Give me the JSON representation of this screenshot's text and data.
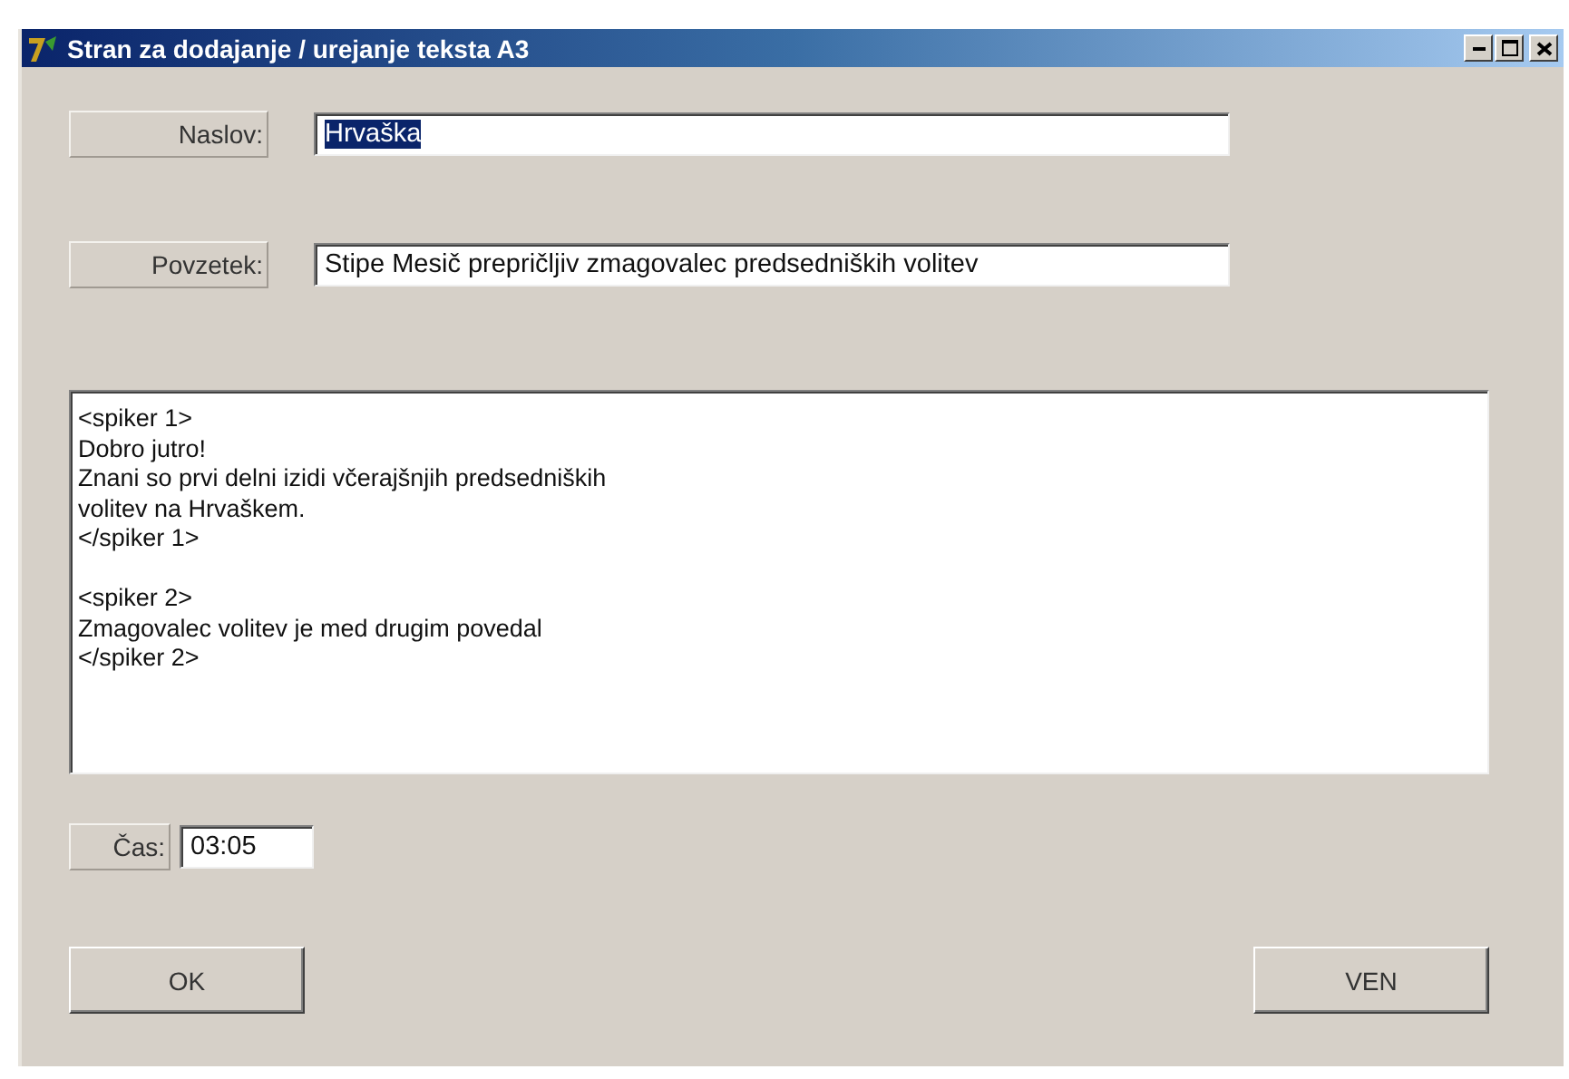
{
  "window": {
    "title": "Stran za dodajanje / urejanje teksta A3"
  },
  "fields": [
    {
      "label": "Naslov:",
      "value": "Hrvaška",
      "selected": true
    },
    {
      "label": "Povzetek:",
      "value": "Stipe Mesič prepričljiv zmagovalec predsedniških volitev",
      "selected": false
    }
  ],
  "text_area": {
    "value": "<spiker 1>\nDobro jutro!\nZnani so prvi delni izidi včerajšnjih predsedniških\nvolitev na Hrvaškem.\n</spiker 1>\n\n<spiker 2>\nZmagovalec volitev je med drugim povedal\n</spiker 2>"
  },
  "time": {
    "label": "Čas:",
    "value": "03:05"
  },
  "buttons": [
    "OK",
    "VEN"
  ]
}
